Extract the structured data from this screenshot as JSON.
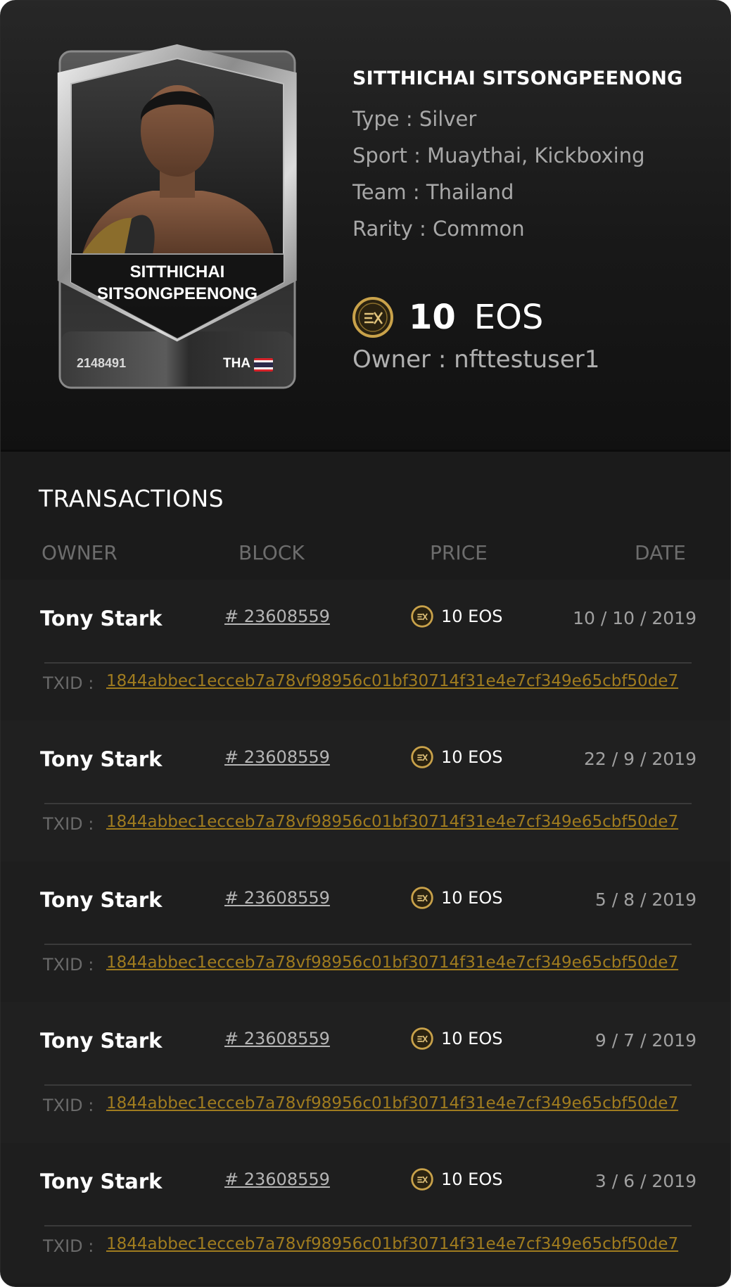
{
  "player": {
    "name": "SITTHICHAI SITSONGPEENONG",
    "card_name_line1": "SITTHICHAI",
    "card_name_line2": "SITSONGPEENONG",
    "card_id": "2148491",
    "country_code": "THA",
    "type": "Type  :  Silver",
    "sport": "Sport :  Muaythai, Kickboxing",
    "team": "Team :  Thailand",
    "rarity": "Rarity : Common",
    "price_value": "10",
    "price_currency": "EOS",
    "owner": "Owner : nfttestuser1"
  },
  "colors": {
    "accent_gold": "#a07c1f",
    "background": "#1b1b1b"
  },
  "transactions": {
    "title": "TRANSACTIONS",
    "columns": {
      "owner": "OWNER",
      "block": "BLOCK",
      "price": "PRICE",
      "date": "DATE"
    },
    "txid_label": "TXID :",
    "rows": [
      {
        "owner": "Tony Stark",
        "block": "# 23608559",
        "price": "10 EOS",
        "date": "10 / 10 / 2019",
        "txid": "1844abbec1ecceb7a78vf98956c01bf30714f31e4e7cf349e65cbf50de7"
      },
      {
        "owner": "Tony Stark",
        "block": "# 23608559",
        "price": "10 EOS",
        "date": "22 / 9 / 2019",
        "txid": "1844abbec1ecceb7a78vf98956c01bf30714f31e4e7cf349e65cbf50de7"
      },
      {
        "owner": "Tony Stark",
        "block": "# 23608559",
        "price": "10 EOS",
        "date": "5 / 8 / 2019",
        "txid": "1844abbec1ecceb7a78vf98956c01bf30714f31e4e7cf349e65cbf50de7"
      },
      {
        "owner": "Tony Stark",
        "block": "# 23608559",
        "price": "10 EOS",
        "date": "9 / 7 / 2019",
        "txid": "1844abbec1ecceb7a78vf98956c01bf30714f31e4e7cf349e65cbf50de7"
      },
      {
        "owner": "Tony Stark",
        "block": "# 23608559",
        "price": "10 EOS",
        "date": "3 / 6 / 2019",
        "txid": "1844abbec1ecceb7a78vf98956c01bf30714f31e4e7cf349e65cbf50de7"
      }
    ]
  }
}
